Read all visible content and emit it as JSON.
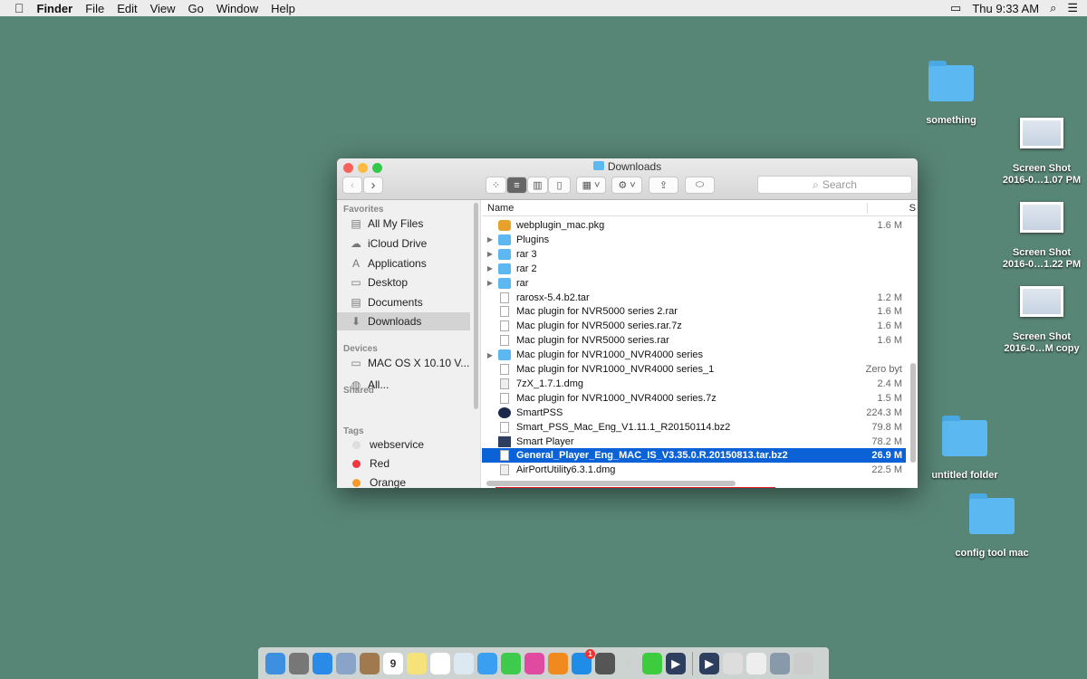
{
  "menubar": {
    "items": [
      "Finder",
      "File",
      "Edit",
      "View",
      "Go",
      "Window",
      "Help"
    ],
    "clock": "Thu 9:33 AM"
  },
  "desktop": [
    {
      "label": "something",
      "type": "folder"
    },
    {
      "label": "Screen Shot\n2016-0…1.07 PM",
      "type": "screenshot"
    },
    {
      "label": "Screen Shot\n2016-0…1.22 PM",
      "type": "screenshot"
    },
    {
      "label": "Screen Shot\n2016-0…M copy",
      "type": "screenshot"
    },
    {
      "label": "untitled folder",
      "type": "folder"
    },
    {
      "label": "config tool mac",
      "type": "folder"
    }
  ],
  "window": {
    "title": "Downloads",
    "search_placeholder": "Search",
    "name_col": "Name",
    "size_col": "S"
  },
  "sidebar": {
    "sections": [
      {
        "title": "Favorites",
        "items": [
          {
            "label": "All My Files",
            "icon": "all-files-icon"
          },
          {
            "label": "iCloud Drive",
            "icon": "cloud-icon"
          },
          {
            "label": "Applications",
            "icon": "applications-icon"
          },
          {
            "label": "Desktop",
            "icon": "desktop-icon"
          },
          {
            "label": "Documents",
            "icon": "documents-icon"
          },
          {
            "label": "Downloads",
            "icon": "downloads-icon",
            "selected": true
          }
        ]
      },
      {
        "title": "Devices",
        "items": [
          {
            "label": "MAC OS X 10.10 V...",
            "icon": "disk-icon"
          }
        ]
      },
      {
        "title": "Shared",
        "items": [
          {
            "label": "All...",
            "icon": "network-icon"
          }
        ]
      },
      {
        "title": "Tags",
        "items": [
          {
            "label": "webservice",
            "color": "#dddddd"
          },
          {
            "label": "Red",
            "color": "#f2373f"
          },
          {
            "label": "Orange",
            "color": "#f79a28"
          }
        ]
      }
    ]
  },
  "files": [
    {
      "name": "webplugin_mac.pkg",
      "size": "1.6 M",
      "kind": "pkg"
    },
    {
      "name": "Plugins",
      "size": "",
      "kind": "folder"
    },
    {
      "name": "rar 3",
      "size": "",
      "kind": "folder"
    },
    {
      "name": "rar 2",
      "size": "",
      "kind": "folder"
    },
    {
      "name": "rar",
      "size": "",
      "kind": "folder"
    },
    {
      "name": "rarosx-5.4.b2.tar",
      "size": "1.2 M",
      "kind": "doc"
    },
    {
      "name": "Mac plugin for NVR5000 series 2.rar",
      "size": "1.6 M",
      "kind": "doc"
    },
    {
      "name": "Mac plugin for NVR5000 series.rar.7z",
      "size": "1.6 M",
      "kind": "doc"
    },
    {
      "name": "Mac plugin for NVR5000 series.rar",
      "size": "1.6 M",
      "kind": "doc"
    },
    {
      "name": "Mac plugin for NVR1000_NVR4000 series",
      "size": "",
      "kind": "folder"
    },
    {
      "name": "Mac plugin for NVR1000_NVR4000 series_1",
      "size": "Zero byt",
      "kind": "doc"
    },
    {
      "name": "7zX_1.7.1.dmg",
      "size": "2.4 M",
      "kind": "dmg"
    },
    {
      "name": "Mac plugin for NVR1000_NVR4000 series.7z",
      "size": "1.5 M",
      "kind": "doc"
    },
    {
      "name": "SmartPSS",
      "size": "224.3 M",
      "kind": "app"
    },
    {
      "name": "Smart_PSS_Mac_Eng_V1.11.1_R20150114.bz2",
      "size": "79.8 M",
      "kind": "doc"
    },
    {
      "name": "Smart Player",
      "size": "78.2 M",
      "kind": "player"
    },
    {
      "name": "General_Player_Eng_MAC_IS_V3.35.0.R.20150813.tar.bz2",
      "size": "26.9 M",
      "kind": "doc",
      "selected": true
    },
    {
      "name": "AirPortUtility6.3.1.dmg",
      "size": "22.5 M",
      "kind": "dmg"
    }
  ],
  "dock": {
    "apps": [
      "Finder",
      "Launchpad",
      "Safari",
      "Mail",
      "Contacts",
      "Calendar",
      "Notes",
      "Reminders",
      "Photos",
      "Messages",
      "FaceTime",
      "iTunes",
      "iBooks",
      "App Store",
      "System Preferences",
      "Unknown",
      "Smart Player",
      "Player"
    ],
    "calendar_day": "9",
    "appstore_badge": "1",
    "colors": {
      "accent": "#0b62d6",
      "highlight_box": "#e3172c",
      "desktop": "#588676"
    }
  }
}
